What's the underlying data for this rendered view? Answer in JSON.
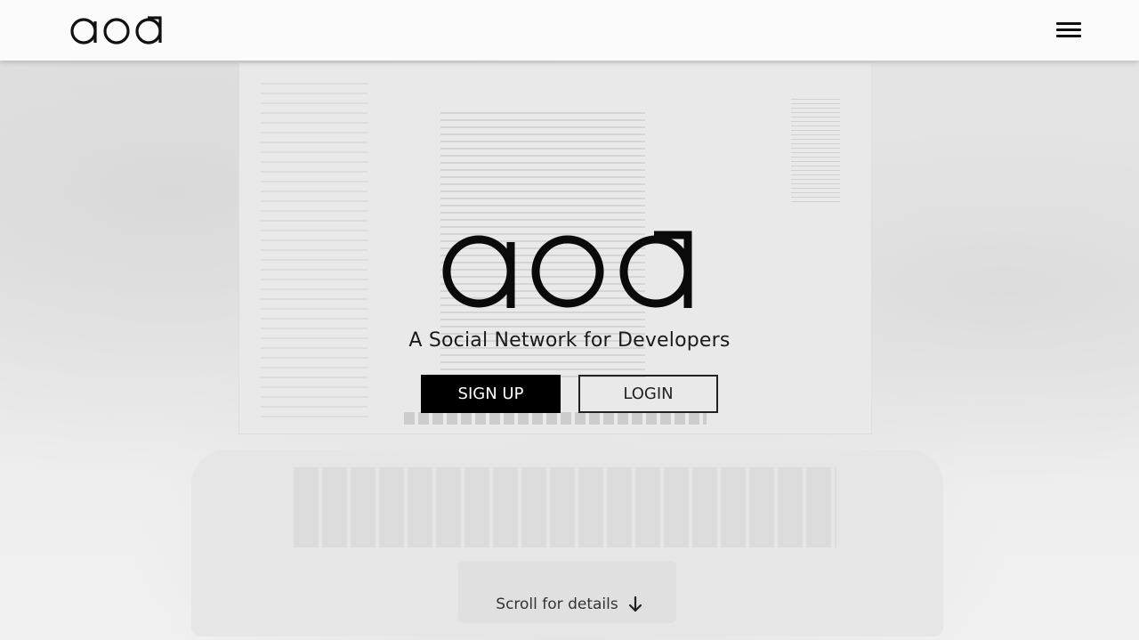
{
  "navbar": {
    "logo_label": "aod",
    "menu_icon": "hamburger-menu-icon"
  },
  "hero": {
    "logo_label": "aod",
    "tagline": "A Social Network for Developers",
    "signup_label": "SIGN UP",
    "login_label": "LOGIN",
    "scroll_text": "Scroll for details",
    "scroll_icon": "arrow-down-icon"
  },
  "colors": {
    "primary_button_bg": "#000000",
    "primary_button_text": "#ffffff",
    "navbar_bg": "#fbfbfb",
    "page_bg": "#efefef"
  }
}
